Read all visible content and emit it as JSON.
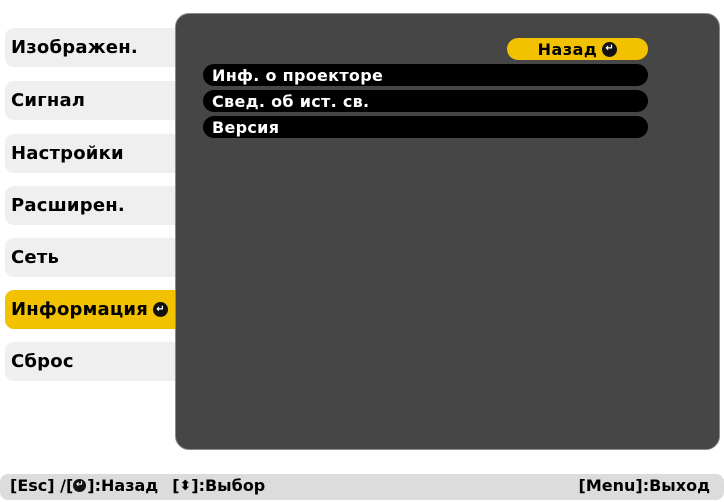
{
  "sidebar": {
    "items": [
      {
        "label": "Изображен."
      },
      {
        "label": "Сигнал"
      },
      {
        "label": "Настройки"
      },
      {
        "label": "Расширен."
      },
      {
        "label": "Сеть"
      },
      {
        "label": "Информация"
      },
      {
        "label": "Сброс"
      }
    ],
    "active_index": 5
  },
  "panel": {
    "back_label": "Назад",
    "rows": [
      {
        "label": "Инф. о проекторе"
      },
      {
        "label": "Свед. об ист. св."
      },
      {
        "label": "Версия"
      }
    ]
  },
  "footer": {
    "esc_text": "[Esc] /[",
    "back_text": "]:Назад",
    "select_prefix": "[",
    "select_text": "]:Выбор",
    "menu_text": "[Menu]:Выход"
  },
  "colors": {
    "accent": "#f2c200",
    "panel": "#464646",
    "tab": "#efefef",
    "footer": "#dcdcdc"
  },
  "icons": {
    "enter": "enter-icon",
    "updown": "updown-arrow-icon"
  }
}
